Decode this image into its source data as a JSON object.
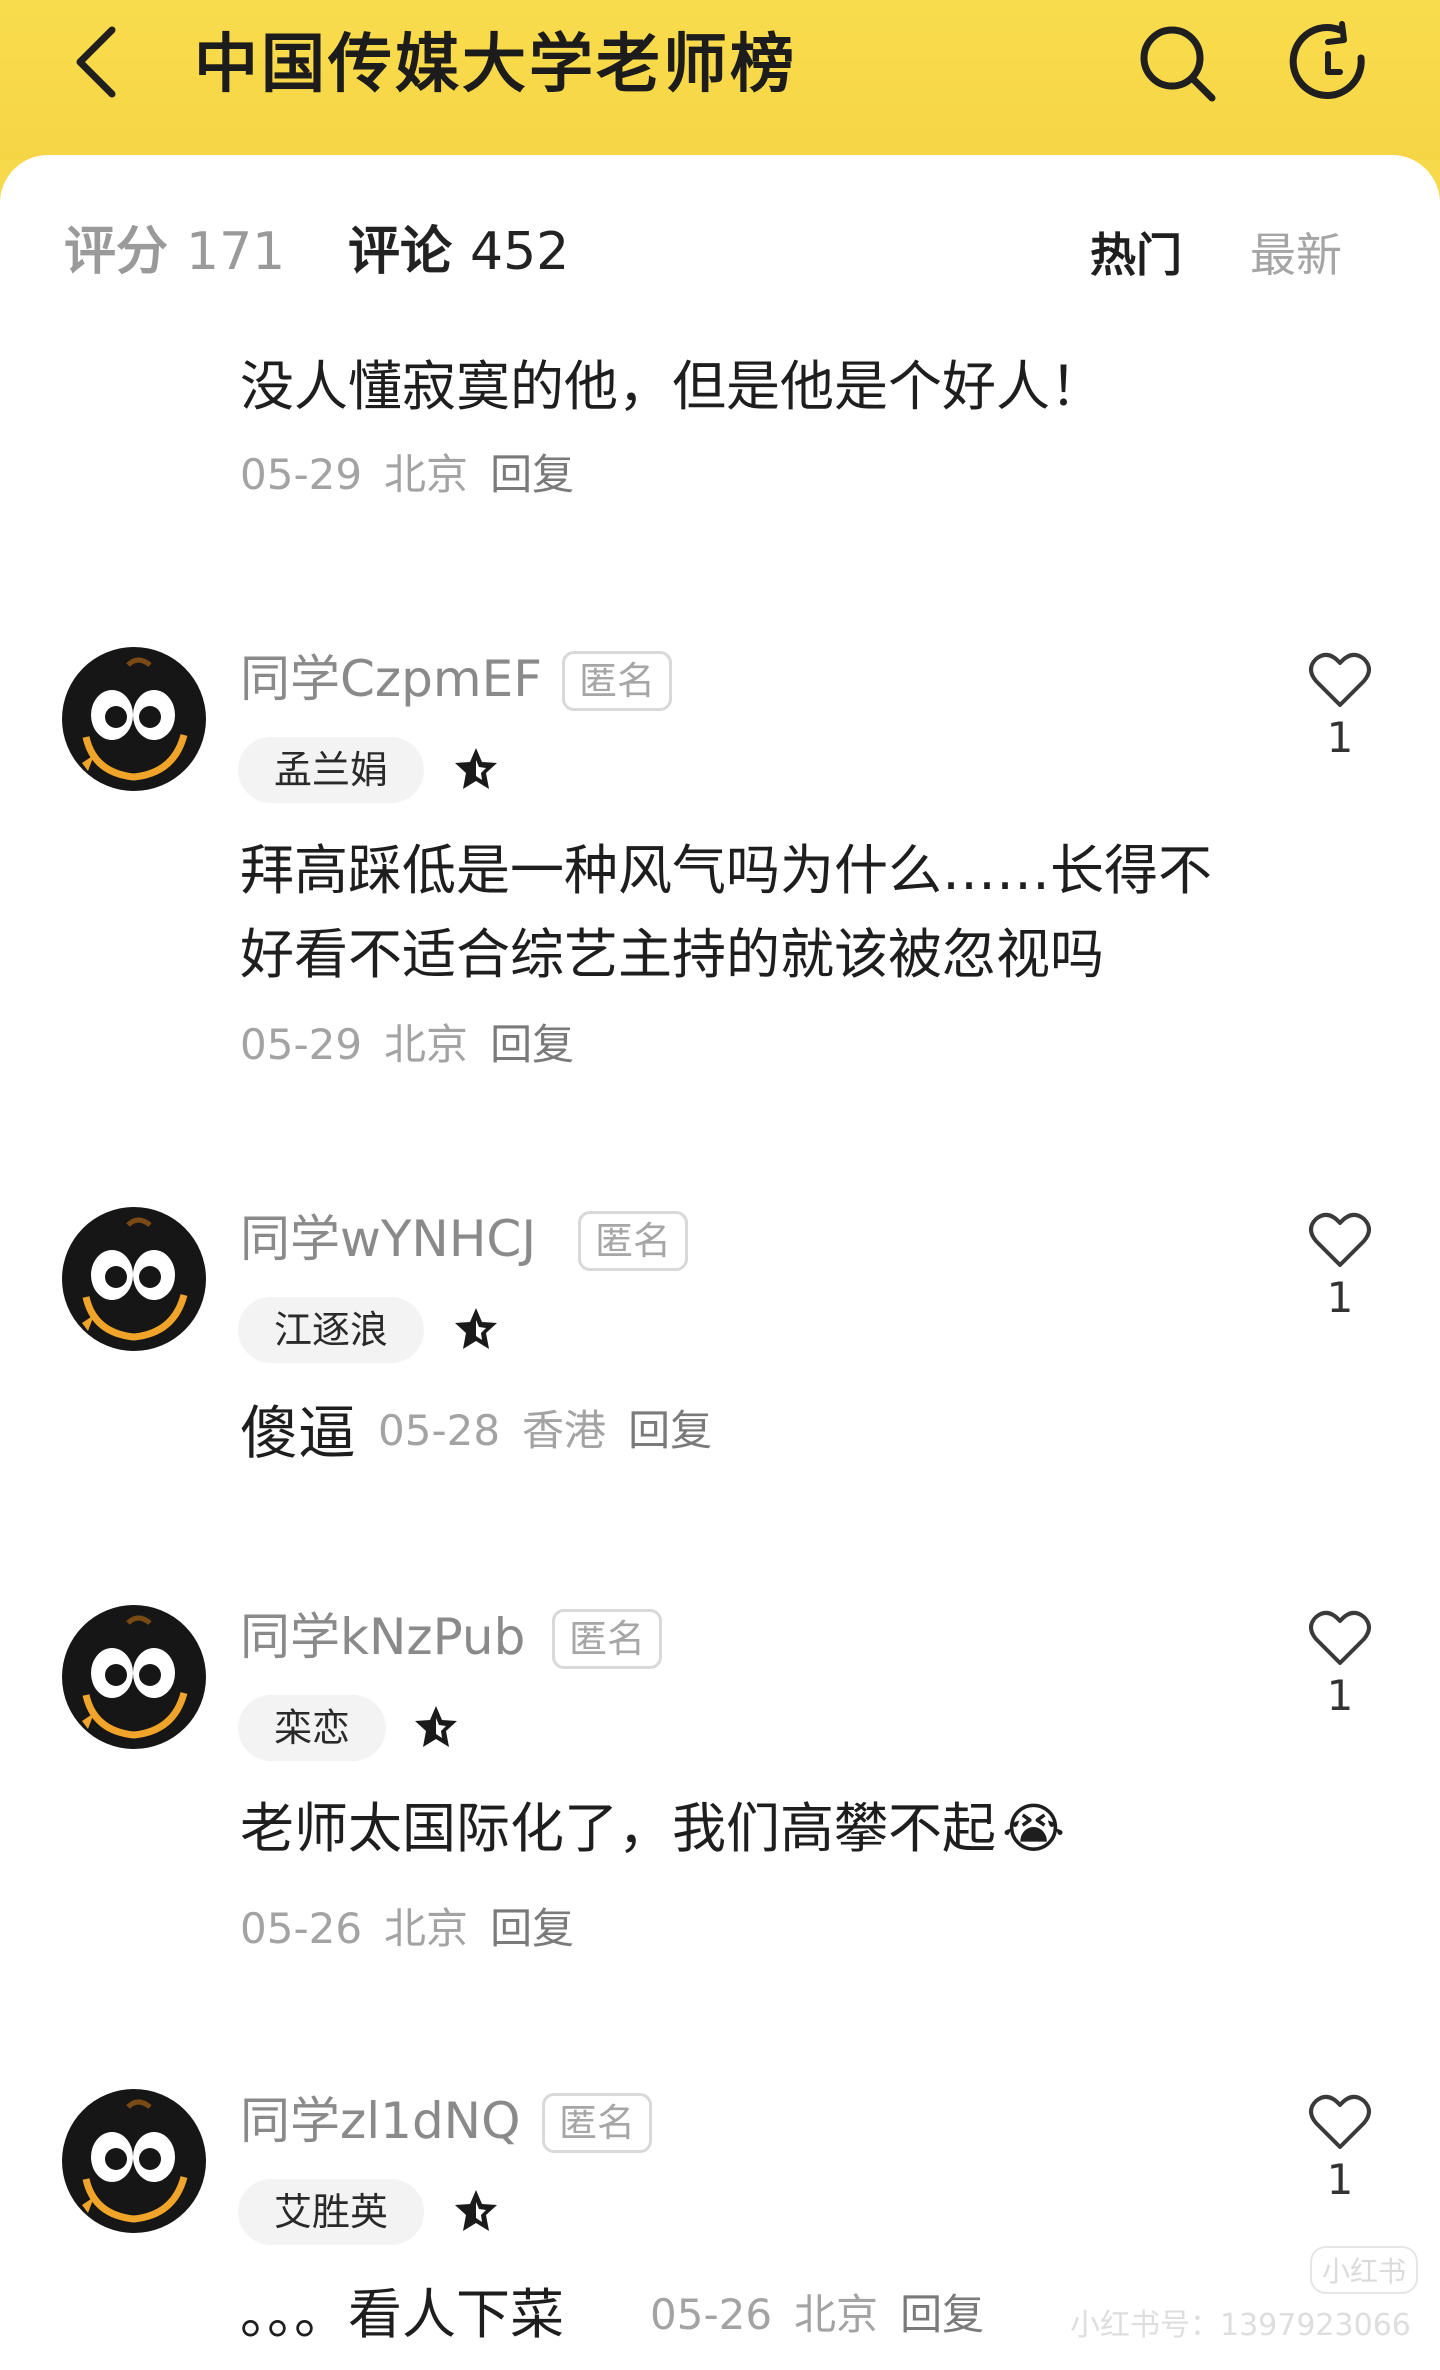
{
  "header": {
    "title": "中国传媒大学老师榜",
    "background_color": "#f7d94c",
    "icons": [
      "chevron-left-icon",
      "search-icon",
      "refresh-icon"
    ]
  },
  "tabs": {
    "rating_label": "评分",
    "rating_count": "171",
    "comments_label": "评论",
    "comments_count": "452",
    "sort_hot": "热门",
    "sort_new": "最新"
  },
  "top_comment": {
    "text": "没人懂寂寞的他，但是他是个好人！",
    "date": "05-29",
    "location": "北京",
    "reply": "回复"
  },
  "comments": [
    {
      "username": "同学CzpmEF",
      "badge": "匿名",
      "teacher": "孟兰娟",
      "lines": [
        "拜高踩低是一种风气吗为什么……长得不",
        "好看不适合综艺主持的就该被忽视吗"
      ],
      "date": "05-29",
      "location": "北京",
      "reply": "回复",
      "likes": "1"
    },
    {
      "username": "同学wYNHCJ",
      "badge": "匿名",
      "teacher": "江逐浪",
      "text": "傻逼",
      "date": "05-28",
      "location": "香港",
      "reply": "回复",
      "likes": "1"
    },
    {
      "username": "同学kNzPub",
      "badge": "匿名",
      "teacher": "栾恋",
      "text": "老师太国际化了，我们高攀不起",
      "emoji": "😭",
      "date": "05-26",
      "location": "北京",
      "reply": "回复",
      "likes": "1"
    },
    {
      "username": "同学zl1dNQ",
      "badge": "匿名",
      "teacher": "艾胜英",
      "text": "。。。看人下菜",
      "date": "05-26",
      "location": "北京",
      "reply": "回复",
      "likes": "1"
    }
  ],
  "watermark": {
    "text": "小红书号：1397923066",
    "logo": "小红书"
  }
}
